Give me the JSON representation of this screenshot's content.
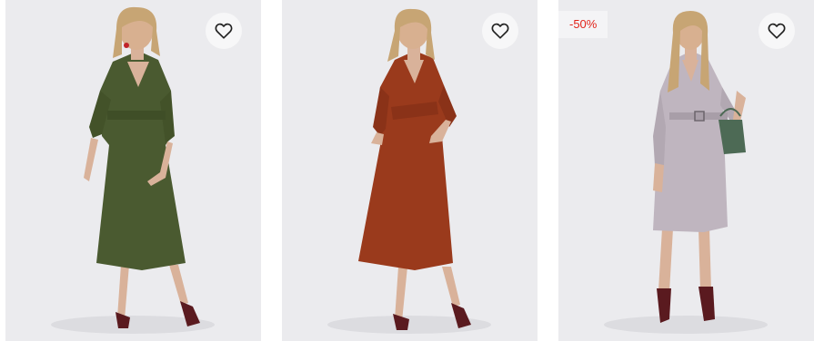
{
  "products": [
    {
      "dress_color": "#4a5a30",
      "has_badge": false,
      "badge": ""
    },
    {
      "dress_color": "#9a3a1c",
      "has_badge": false,
      "badge": ""
    },
    {
      "dress_color": "#bfb5bf",
      "has_badge": true,
      "badge": "-50%"
    }
  ],
  "icons": {
    "favorite": "heart-outline-icon"
  },
  "colors": {
    "card_bg": "#ebebee",
    "badge_text": "#e2231a",
    "heart_stroke": "#222222"
  }
}
